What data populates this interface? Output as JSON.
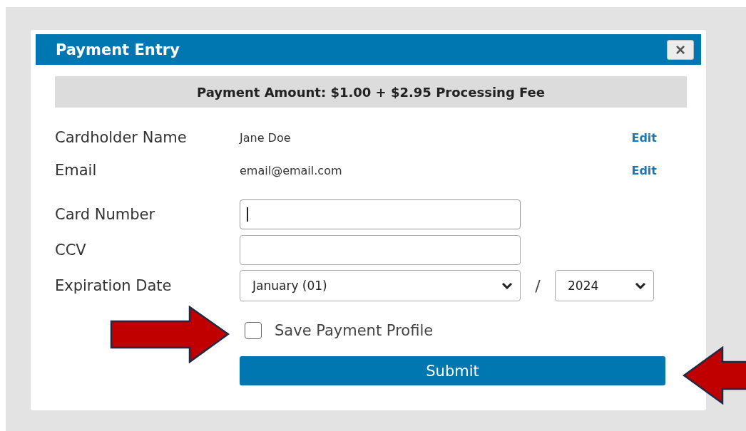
{
  "dialog": {
    "title": "Payment Entry",
    "close": "×"
  },
  "amount_banner": "Payment Amount: $1.00 + $2.95 Processing Fee",
  "info_rows": [
    {
      "label": "Cardholder Name",
      "value": "Jane Doe",
      "action": "Edit"
    },
    {
      "label": "Email",
      "value": "email@email.com",
      "action": "Edit"
    }
  ],
  "card_number": {
    "label": "Card Number",
    "focused": true
  },
  "ccv": {
    "label": "CCV"
  },
  "expiration": {
    "label": "Expiration Date",
    "month": "January (01)",
    "separator": "/",
    "year": "2024"
  },
  "save_profile": {
    "label": "Save Payment Profile",
    "checked": false
  },
  "submit": "Submit"
}
